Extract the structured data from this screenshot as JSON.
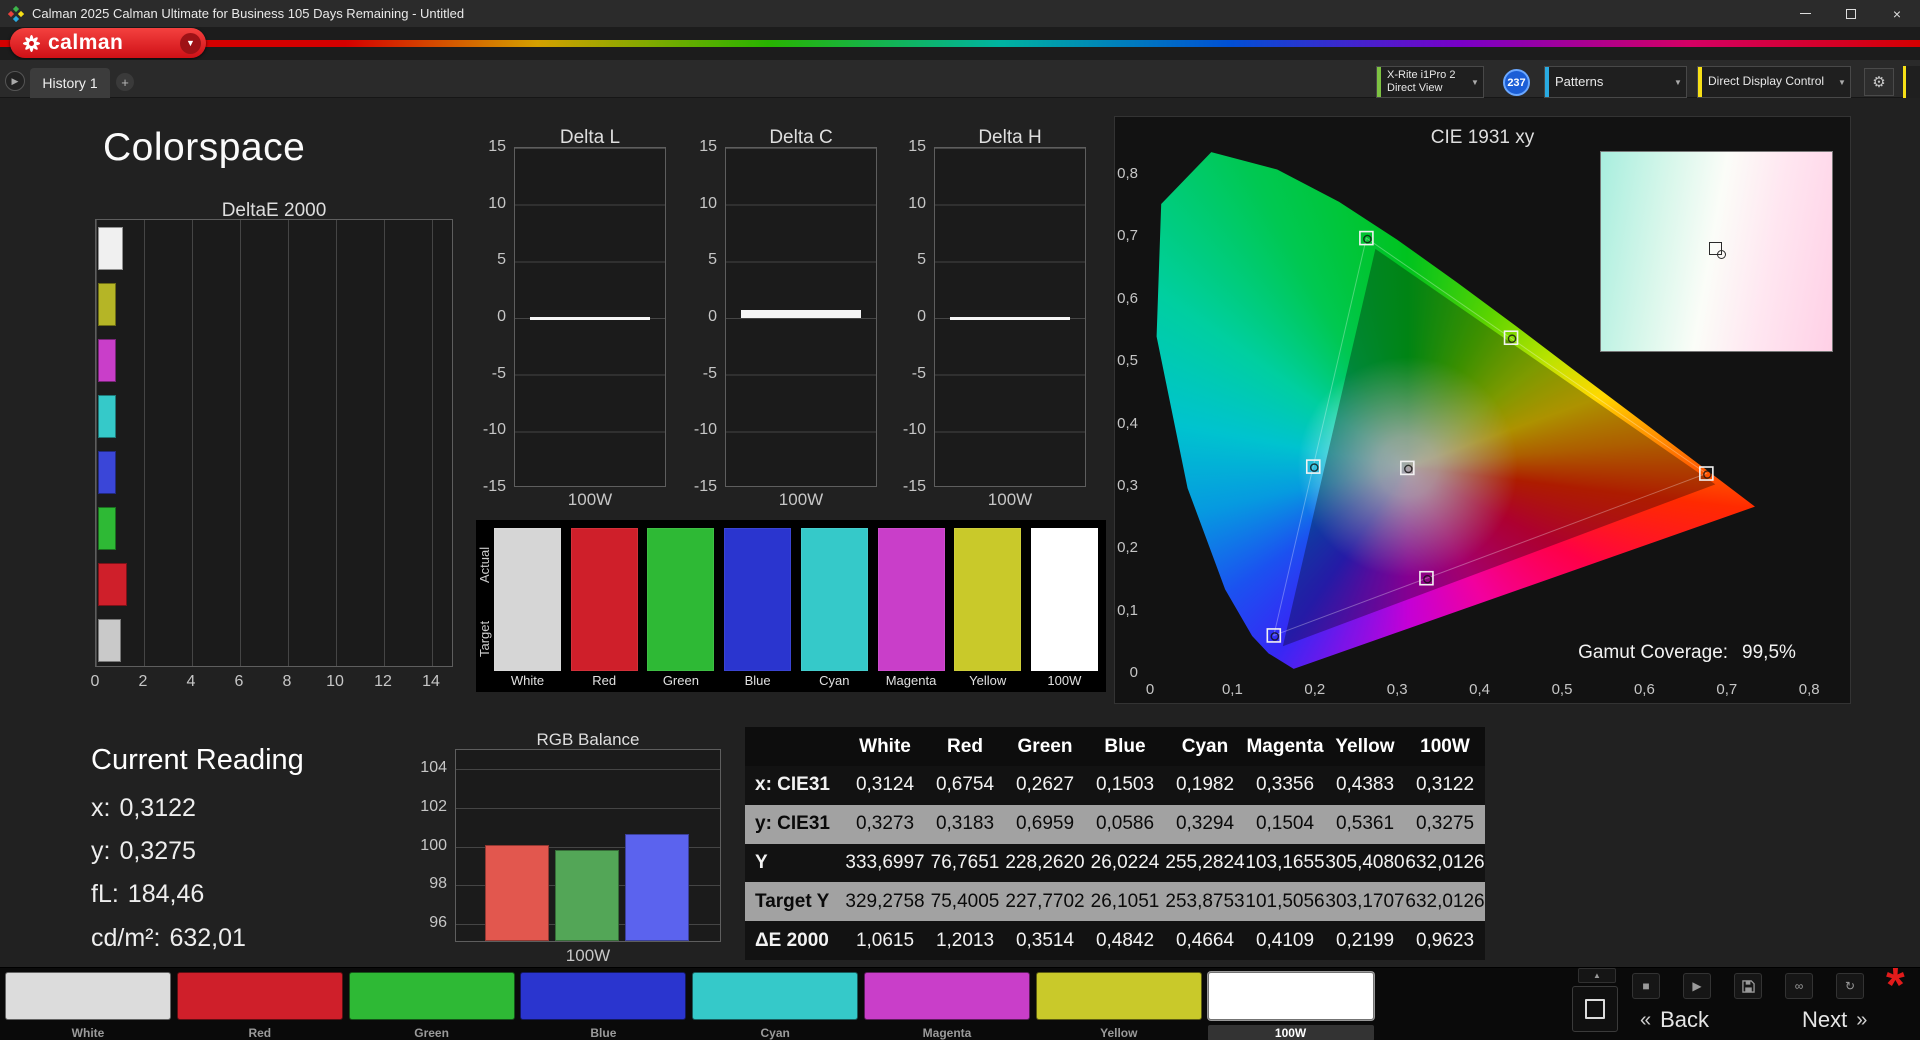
{
  "icons": {
    "dropdown": "▼",
    "gear": "⚙",
    "add_tab": "+",
    "tab_arrow": "▶",
    "back_chevron": "«",
    "next_chevron": "»",
    "up_chevron": "▲",
    "stop": "■",
    "play": "▶",
    "link": "∞",
    "refresh": "↻",
    "asterisk": "*",
    "close": "×"
  },
  "window": {
    "title": "Calman 2025 Calman Ultimate for Business 105 Days Remaining  - Untitled"
  },
  "brand": {
    "logo_text": "calman",
    "accent": "#e31e26"
  },
  "tab_bar": {
    "tabs": [
      {
        "label": "History 1"
      }
    ],
    "meter": {
      "line1": "X-Rite i1Pro 2",
      "line2": "Direct View",
      "accent": "#7dc242"
    },
    "badge": "237",
    "patterns": {
      "label": "Patterns",
      "accent": "#29abe2"
    },
    "display_control": {
      "label": "Direct Display Control",
      "accent": "#f7e017"
    }
  },
  "page": {
    "title": "Colorspace"
  },
  "charts": {
    "deltae": {
      "title": "DeltaE 2000",
      "x_ticks": [
        "0",
        "2",
        "4",
        "6",
        "8",
        "10",
        "12",
        "14"
      ],
      "bars": [
        {
          "name": "White",
          "value": 1.0615,
          "color": "#f0f0f0"
        },
        {
          "name": "Yellow",
          "value": 0.2199,
          "color": "#b5b526"
        },
        {
          "name": "Magenta",
          "value": 0.4109,
          "color": "#c93ec9"
        },
        {
          "name": "Cyan",
          "value": 0.4664,
          "color": "#35c9c9"
        },
        {
          "name": "Blue",
          "value": 0.4842,
          "color": "#3a46d8"
        },
        {
          "name": "Green",
          "value": 0.3514,
          "color": "#2eb935"
        },
        {
          "name": "Red",
          "value": 1.2013,
          "color": "#cf1f2a"
        },
        {
          "name": "100W",
          "value": 0.9623,
          "color": "#c9c9c9"
        }
      ]
    },
    "delta_y_ticks": [
      "15",
      "10",
      "5",
      "0",
      "-5",
      "-10",
      "-15"
    ],
    "delta_charts": [
      {
        "title": "Delta L",
        "x_label": "100W",
        "value": 0.0
      },
      {
        "title": "Delta C",
        "x_label": "100W",
        "value": 0.7
      },
      {
        "title": "Delta H",
        "x_label": "100W",
        "value": 0.0
      }
    ],
    "rgb_balance": {
      "title": "RGB Balance",
      "x_label": "100W",
      "y_ticks": [
        104,
        102,
        100,
        98,
        96
      ],
      "bars": [
        {
          "name": "Red",
          "value": 100.0,
          "color": "#e2574e"
        },
        {
          "name": "Green",
          "value": 99.7,
          "color": "#53a657"
        },
        {
          "name": "Blue",
          "value": 100.55,
          "color": "#5b63ee"
        }
      ]
    },
    "cie": {
      "title": "CIE 1931 xy",
      "x_ticks": [
        "0",
        "0,1",
        "0,2",
        "0,3",
        "0,4",
        "0,5",
        "0,6",
        "0,7",
        "0,8"
      ],
      "y_ticks": [
        "0,8",
        "0,7",
        "0,6",
        "0,5",
        "0,4",
        "0,3",
        "0,2",
        "0,1",
        "0"
      ],
      "gamut_label": "Gamut Coverage:",
      "gamut_value": "99,5%",
      "points": [
        {
          "name": "white",
          "x": 0.3124,
          "y": 0.3273
        },
        {
          "name": "red",
          "x": 0.6754,
          "y": 0.3183
        },
        {
          "name": "green",
          "x": 0.2627,
          "y": 0.6959
        },
        {
          "name": "blue",
          "x": 0.1503,
          "y": 0.0586
        },
        {
          "name": "cyan",
          "x": 0.1982,
          "y": 0.3294
        },
        {
          "name": "magenta",
          "x": 0.3356,
          "y": 0.1504
        },
        {
          "name": "yellow",
          "x": 0.4383,
          "y": 0.5361
        }
      ],
      "triangle": [
        "red",
        "green",
        "blue"
      ]
    }
  },
  "swatch_strip": {
    "row_labels": [
      "Actual",
      "Target"
    ],
    "swatches": [
      {
        "label": "White",
        "color": "#d6d6d6"
      },
      {
        "label": "Red",
        "color": "#cf1f2a"
      },
      {
        "label": "Green",
        "color": "#2eb935"
      },
      {
        "label": "Blue",
        "color": "#2a35cf"
      },
      {
        "label": "Cyan",
        "color": "#35c9c9"
      },
      {
        "label": "Magenta",
        "color": "#c93ec9"
      },
      {
        "label": "Yellow",
        "color": "#c9c92a"
      },
      {
        "label": "100W",
        "color": "#ffffff"
      }
    ]
  },
  "current_reading": {
    "title": "Current Reading",
    "lines": [
      {
        "label": "x:",
        "value": "0,3122"
      },
      {
        "label": "y:",
        "value": "0,3275"
      },
      {
        "label": "fL:",
        "value": "184,46"
      },
      {
        "label": "cd/m²:",
        "value": "632,01"
      }
    ]
  },
  "table": {
    "columns": [
      "White",
      "Red",
      "Green",
      "Blue",
      "Cyan",
      "Magenta",
      "Yellow",
      "100W"
    ],
    "rows": [
      {
        "label": "x: CIE31",
        "shade": "dark",
        "values": [
          "0,3124",
          "0,6754",
          "0,2627",
          "0,1503",
          "0,1982",
          "0,3356",
          "0,4383",
          "0,3122"
        ]
      },
      {
        "label": "y: CIE31",
        "shade": "light",
        "values": [
          "0,3273",
          "0,3183",
          "0,6959",
          "0,0586",
          "0,3294",
          "0,1504",
          "0,5361",
          "0,3275"
        ]
      },
      {
        "label": "Y",
        "shade": "dark",
        "values": [
          "333,6997",
          "76,7651",
          "228,2620",
          "26,0224",
          "255,2824",
          "103,1655",
          "305,4080",
          "632,0126"
        ]
      },
      {
        "label": "Target Y",
        "shade": "light",
        "values": [
          "329,2758",
          "75,4005",
          "227,7702",
          "26,1051",
          "253,8753",
          "101,5056",
          "303,1707",
          "632,0126"
        ]
      },
      {
        "label": "ΔE 2000",
        "shade": "dark",
        "values": [
          "1,0615",
          "1,2013",
          "0,3514",
          "0,4842",
          "0,4664",
          "0,4109",
          "0,2199",
          "0,9623"
        ]
      }
    ]
  },
  "pattern_bar": {
    "patterns": [
      {
        "label": "White",
        "color": "#dcdcdc",
        "selected": false
      },
      {
        "label": "Red",
        "color": "#cf1f2a",
        "selected": false
      },
      {
        "label": "Green",
        "color": "#2eb935",
        "selected": false
      },
      {
        "label": "Blue",
        "color": "#2a35cf",
        "selected": false
      },
      {
        "label": "Cyan",
        "color": "#35c9c9",
        "selected": false
      },
      {
        "label": "Magenta",
        "color": "#c93ec9",
        "selected": false
      },
      {
        "label": "Yellow",
        "color": "#c9c92a",
        "selected": false
      },
      {
        "label": "100W",
        "color": "#ffffff",
        "selected": true
      }
    ]
  },
  "nav": {
    "back": "Back",
    "next": "Next"
  }
}
